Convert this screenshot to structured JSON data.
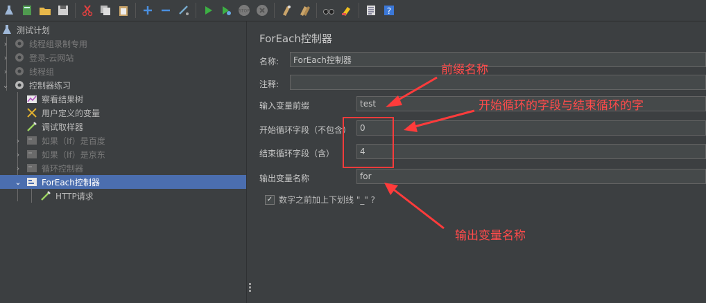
{
  "toolbar": {
    "icons": [
      "test-plan-icon",
      "templates-icon",
      "open-icon",
      "save-icon",
      "cut-icon",
      "copy-icon",
      "paste-icon",
      "expand-icon",
      "collapse-icon",
      "toggle-icon",
      "start-icon",
      "start-no-pause-icon",
      "stop-icon",
      "shutdown-icon",
      "clear-icon",
      "clear-all-icon",
      "search-icon",
      "reset-search-icon",
      "function-helper-icon",
      "help-icon"
    ]
  },
  "tree": {
    "items": [
      {
        "label": "测试计划",
        "icon": "test-plan-icon",
        "enabled": true
      },
      {
        "label": "线程组录制专用",
        "icon": "gear-icon",
        "enabled": false
      },
      {
        "label": "登录-云网站",
        "icon": "gear-icon",
        "enabled": false
      },
      {
        "label": "线程组",
        "icon": "gear-icon",
        "enabled": false
      },
      {
        "label": "控制器练习",
        "icon": "gear-icon",
        "enabled": true
      },
      {
        "label": "察看结果树",
        "icon": "chart-icon",
        "enabled": true
      },
      {
        "label": "用户定义的变量",
        "icon": "wrench-icon",
        "enabled": true
      },
      {
        "label": "调试取样器",
        "icon": "pipette-icon",
        "enabled": true
      },
      {
        "label": "如果（If）是百度",
        "icon": "controller-icon",
        "enabled": false
      },
      {
        "label": "如果（If）是京东",
        "icon": "controller-icon",
        "enabled": false
      },
      {
        "label": "循环控制器",
        "icon": "controller-icon",
        "enabled": false
      },
      {
        "label": "ForEach控制器",
        "icon": "controller-icon",
        "enabled": true,
        "selected": true
      },
      {
        "label": "HTTP请求",
        "icon": "pipette-icon",
        "enabled": true
      }
    ]
  },
  "panel": {
    "title": "ForEach控制器",
    "name_label": "名称:",
    "name_value": "ForEach控制器",
    "comment_label": "注释:",
    "comment_value": "",
    "prefix_label": "输入变量前缀",
    "prefix_value": "test",
    "start_label": "开始循环字段（不包含）",
    "start_value": "0",
    "end_label": "结束循环字段（含）",
    "end_value": "4",
    "output_label": "输出变量名称",
    "output_value": "for",
    "checkbox_label": "数字之前加上下划线 \"_\" ?",
    "checkbox_checked": true
  },
  "annotations": {
    "prefix_note": "前缀名称",
    "range_note": "开始循环的字段与结束循环的字",
    "output_note": "输出变量名称",
    "color": "#ff3b3b"
  }
}
